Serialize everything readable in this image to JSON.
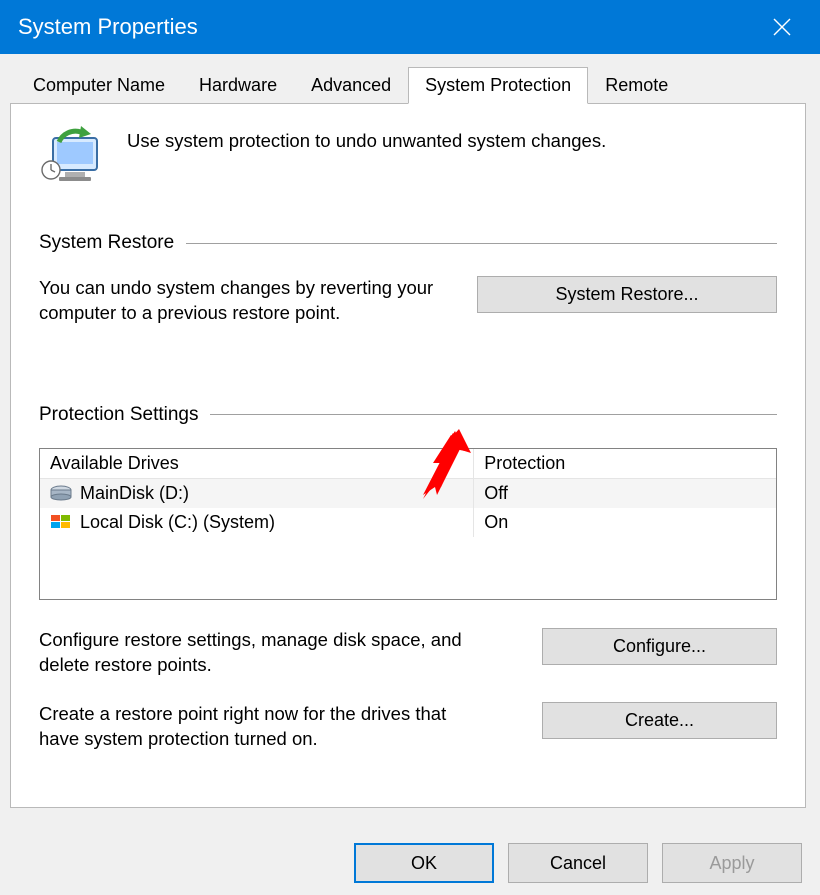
{
  "window": {
    "title": "System Properties"
  },
  "tabs": [
    {
      "label": "Computer Name",
      "active": false
    },
    {
      "label": "Hardware",
      "active": false
    },
    {
      "label": "Advanced",
      "active": false
    },
    {
      "label": "System Protection",
      "active": true
    },
    {
      "label": "Remote",
      "active": false
    }
  ],
  "intro_text": "Use system protection to undo unwanted system changes.",
  "system_restore": {
    "group_title": "System Restore",
    "desc": "You can undo system changes by reverting your computer to a previous restore point.",
    "button": "System Restore..."
  },
  "protection_settings": {
    "group_title": "Protection Settings",
    "col_drives": "Available Drives",
    "col_protection": "Protection",
    "drives": [
      {
        "icon": "hdd-icon",
        "name": "MainDisk (D:)",
        "protection": "Off"
      },
      {
        "icon": "windows-drive-icon",
        "name": "Local Disk (C:) (System)",
        "protection": "On"
      }
    ],
    "configure_desc": "Configure restore settings, manage disk space, and delete restore points.",
    "configure_button": "Configure...",
    "create_desc": "Create a restore point right now for the drives that have system protection turned on.",
    "create_button": "Create..."
  },
  "footer": {
    "ok": "OK",
    "cancel": "Cancel",
    "apply": "Apply"
  }
}
